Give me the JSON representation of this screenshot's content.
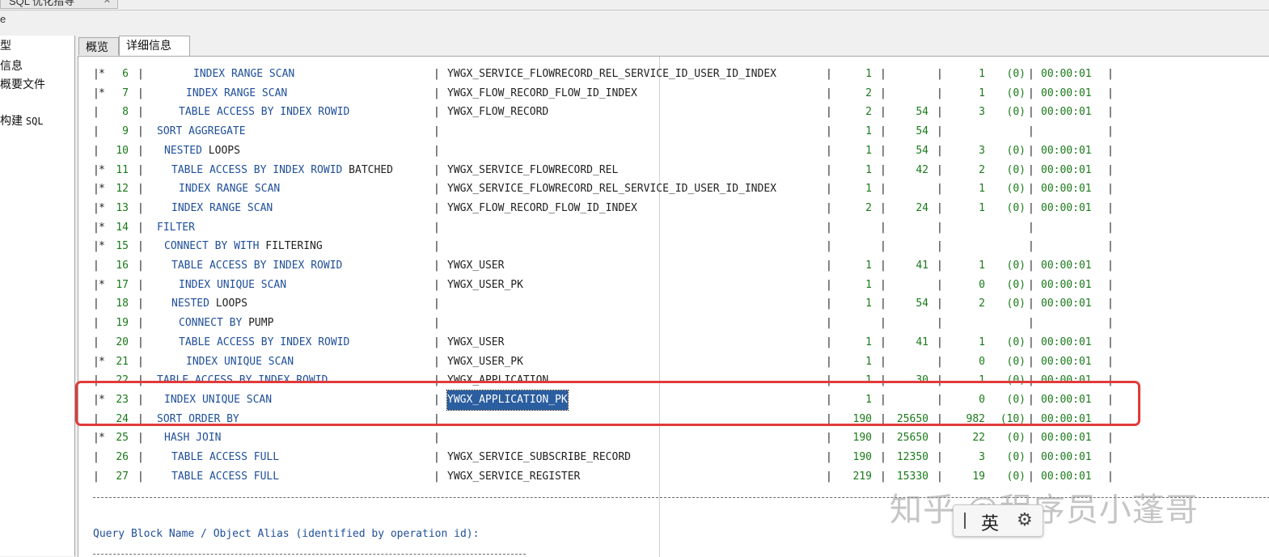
{
  "window": {
    "tab_title": "SQL 优化指导",
    "menu_fragment": "e"
  },
  "sidebar": {
    "items": [
      "型",
      "信息",
      "概要文件",
      "构建"
    ],
    "items_suffix": "SQL"
  },
  "tabs": [
    {
      "label": "概览",
      "active": false
    },
    {
      "label": "详细信息",
      "active": true
    }
  ],
  "plan_rows": [
    {
      "mark": "*",
      "id": "6",
      "indent": 5,
      "op": "INDEX RANGE SCAN",
      "obj": "YWGX_SERVICE_FLOWRECORD_REL_SERVICE_ID_USER_ID_INDEX",
      "rows": "1",
      "bytes": "",
      "cost": "1",
      "cpu": "(0)",
      "time": "00:00:01"
    },
    {
      "mark": "*",
      "id": "7",
      "indent": 4,
      "op": "INDEX RANGE SCAN",
      "obj": "YWGX_FLOW_RECORD_FLOW_ID_INDEX",
      "rows": "2",
      "bytes": "",
      "cost": "1",
      "cpu": "(0)",
      "time": "00:00:01"
    },
    {
      "mark": "",
      "id": "8",
      "indent": 3,
      "op": "TABLE ACCESS BY INDEX ROWID",
      "obj": "YWGX_FLOW_RECORD",
      "rows": "2",
      "bytes": "54",
      "cost": "3",
      "cpu": "(0)",
      "time": "00:00:01"
    },
    {
      "mark": "",
      "id": "9",
      "indent": 0,
      "op": "SORT AGGREGATE",
      "obj": "",
      "rows": "1",
      "bytes": "54",
      "cost": "",
      "cpu": "",
      "time": ""
    },
    {
      "mark": "",
      "id": "10",
      "indent": 1,
      "op": "NESTED LOOPS",
      "obj": "",
      "rows": "1",
      "bytes": "54",
      "cost": "3",
      "cpu": "(0)",
      "time": "00:00:01"
    },
    {
      "mark": "*",
      "id": "11",
      "indent": 2,
      "op": "TABLE ACCESS BY INDEX ROWID BATCHED",
      "obj": "YWGX_SERVICE_FLOWRECORD_REL",
      "rows": "1",
      "bytes": "42",
      "cost": "2",
      "cpu": "(0)",
      "time": "00:00:01"
    },
    {
      "mark": "*",
      "id": "12",
      "indent": 3,
      "op": "INDEX RANGE SCAN",
      "obj": "YWGX_SERVICE_FLOWRECORD_REL_SERVICE_ID_USER_ID_INDEX",
      "rows": "1",
      "bytes": "",
      "cost": "1",
      "cpu": "(0)",
      "time": "00:00:01"
    },
    {
      "mark": "*",
      "id": "13",
      "indent": 2,
      "op": "INDEX RANGE SCAN",
      "obj": "YWGX_FLOW_RECORD_FLOW_ID_INDEX",
      "rows": "2",
      "bytes": "24",
      "cost": "1",
      "cpu": "(0)",
      "time": "00:00:01"
    },
    {
      "mark": "*",
      "id": "14",
      "indent": 0,
      "op": "FILTER",
      "obj": "",
      "rows": "",
      "bytes": "",
      "cost": "",
      "cpu": "",
      "time": ""
    },
    {
      "mark": "*",
      "id": "15",
      "indent": 1,
      "op": "CONNECT BY WITH FILTERING",
      "obj": "",
      "rows": "",
      "bytes": "",
      "cost": "",
      "cpu": "",
      "time": ""
    },
    {
      "mark": "",
      "id": "16",
      "indent": 2,
      "op": "TABLE ACCESS BY INDEX ROWID",
      "obj": "YWGX_USER",
      "rows": "1",
      "bytes": "41",
      "cost": "1",
      "cpu": "(0)",
      "time": "00:00:01"
    },
    {
      "mark": "*",
      "id": "17",
      "indent": 3,
      "op": "INDEX UNIQUE SCAN",
      "obj": "YWGX_USER_PK",
      "rows": "1",
      "bytes": "",
      "cost": "0",
      "cpu": "(0)",
      "time": "00:00:01"
    },
    {
      "mark": "",
      "id": "18",
      "indent": 2,
      "op": "NESTED LOOPS",
      "obj": "",
      "rows": "1",
      "bytes": "54",
      "cost": "2",
      "cpu": "(0)",
      "time": "00:00:01"
    },
    {
      "mark": "",
      "id": "19",
      "indent": 3,
      "op": "CONNECT BY PUMP",
      "obj": "",
      "rows": "",
      "bytes": "",
      "cost": "",
      "cpu": "",
      "time": ""
    },
    {
      "mark": "",
      "id": "20",
      "indent": 3,
      "op": "TABLE ACCESS BY INDEX ROWID",
      "obj": "YWGX_USER",
      "rows": "1",
      "bytes": "41",
      "cost": "1",
      "cpu": "(0)",
      "time": "00:00:01"
    },
    {
      "mark": "*",
      "id": "21",
      "indent": 4,
      "op": "INDEX UNIQUE SCAN",
      "obj": "YWGX_USER_PK",
      "rows": "1",
      "bytes": "",
      "cost": "0",
      "cpu": "(0)",
      "time": "00:00:01"
    },
    {
      "mark": "",
      "id": "22",
      "indent": 0,
      "op": "TABLE ACCESS BY INDEX ROWID",
      "obj": "YWGX_APPLICATION",
      "rows": "1",
      "bytes": "30",
      "cost": "1",
      "cpu": "(0)",
      "time": "00:00:01"
    },
    {
      "mark": "*",
      "id": "23",
      "indent": 1,
      "op": "INDEX UNIQUE SCAN",
      "obj": "YWGX_APPLICATION_PK",
      "rows": "1",
      "bytes": "",
      "cost": "0",
      "cpu": "(0)",
      "time": "00:00:01"
    },
    {
      "mark": "",
      "id": "24",
      "indent": 0,
      "op": "SORT ORDER BY",
      "obj": "",
      "rows": "190",
      "bytes": "25650",
      "cost": "982",
      "cpu": "(10)",
      "time": "00:00:01"
    },
    {
      "mark": "*",
      "id": "25",
      "indent": 1,
      "op": "HASH JOIN",
      "obj": "",
      "rows": "190",
      "bytes": "25650",
      "cost": "22",
      "cpu": "(0)",
      "time": "00:00:01"
    },
    {
      "mark": "",
      "id": "26",
      "indent": 2,
      "op": "TABLE ACCESS FULL",
      "obj": "YWGX_SERVICE_SUBSCRIBE_RECORD",
      "rows": "190",
      "bytes": "12350",
      "cost": "3",
      "cpu": "(0)",
      "time": "00:00:01"
    },
    {
      "mark": "",
      "id": "27",
      "indent": 2,
      "op": "TABLE ACCESS FULL",
      "obj": "YWGX_SERVICE_REGISTER",
      "rows": "219",
      "bytes": "15330",
      "cost": "19",
      "cpu": "(0)",
      "time": "00:00:01"
    }
  ],
  "selected_object": "YWGX_APPLICATION_PK",
  "query_block_label": "Query Block Name / Object Alias (identified by operation id):",
  "ime": {
    "lang": "英",
    "settings_icon": "gear-icon"
  },
  "watermark": "知乎 @程序员小蓬哥",
  "colors": {
    "keyword": "#1f4f99",
    "number": "#1a7a1a",
    "selection": "#2b5ea0",
    "annotation": "#e23a3a"
  }
}
